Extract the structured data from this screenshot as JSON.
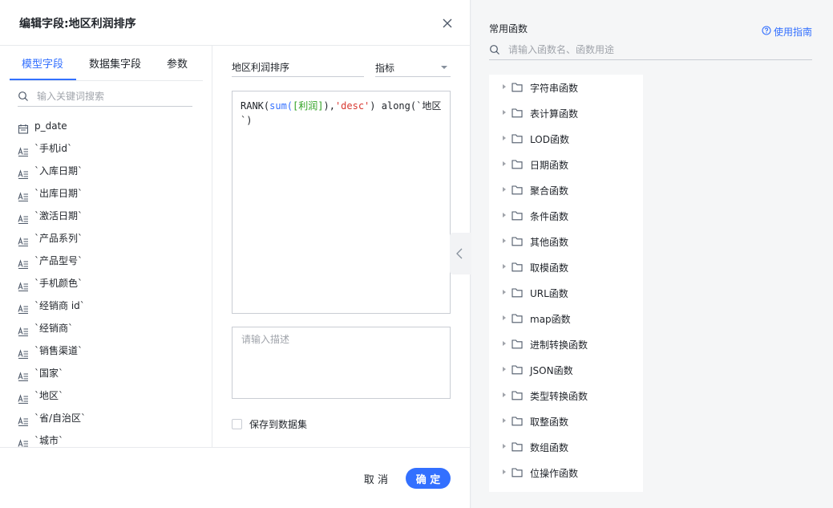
{
  "dialog": {
    "title": "编辑字段:地区利润排序",
    "tabs": [
      {
        "label": "模型字段"
      },
      {
        "label": "数据集字段"
      },
      {
        "label": "参数"
      }
    ],
    "keyword_search": {
      "placeholder": "输入关键词搜索"
    },
    "fields": [
      {
        "name": "p_date",
        "icon": "calendar-icon"
      },
      {
        "name": "`手机id`",
        "icon": "text-field-icon"
      },
      {
        "name": "`入库日期`",
        "icon": "text-field-icon"
      },
      {
        "name": "`出库日期`",
        "icon": "text-field-icon"
      },
      {
        "name": "`激活日期`",
        "icon": "text-field-icon"
      },
      {
        "name": "`产品系列`",
        "icon": "text-field-icon"
      },
      {
        "name": "`产品型号`",
        "icon": "text-field-icon"
      },
      {
        "name": "`手机颜色`",
        "icon": "text-field-icon"
      },
      {
        "name": "`经销商 id`",
        "icon": "text-field-icon"
      },
      {
        "name": "`经销商`",
        "icon": "text-field-icon"
      },
      {
        "name": "`销售渠道`",
        "icon": "text-field-icon"
      },
      {
        "name": "`国家`",
        "icon": "text-field-icon"
      },
      {
        "name": "`地区`",
        "icon": "text-field-icon"
      },
      {
        "name": "`省/自治区`",
        "icon": "text-field-icon"
      },
      {
        "name": "`城市`",
        "icon": "text-field-icon"
      }
    ],
    "field_name": "地区利润排序",
    "field_type": "指标",
    "expression": {
      "fn_rank": "RANK(",
      "fn_sum": "sum(",
      "field_ref": "[利润]",
      "close_sum": "),",
      "string_arg": "'desc'",
      "tail": ") along(`地区`)"
    },
    "description": {
      "placeholder": "请输入描述",
      "value": ""
    },
    "save_to_dataset_label": "保存到数据集",
    "cancel_label": "取 消",
    "ok_label": "确 定"
  },
  "functions_panel": {
    "title": "常用函数",
    "guide_label": "使用指南",
    "search": {
      "placeholder": "请输入函数名、函数用途"
    },
    "categories": [
      "字符串函数",
      "表计算函数",
      "LOD函数",
      "日期函数",
      "聚合函数",
      "条件函数",
      "其他函数",
      "取模函数",
      "URL函数",
      "map函数",
      "进制转换函数",
      "JSON函数",
      "类型转换函数",
      "取整函数",
      "数组函数",
      "位操作函数"
    ]
  },
  "colors": {
    "accent": "#3370ff",
    "field_ref": "#2ea121",
    "string_literal": "#d83931"
  }
}
